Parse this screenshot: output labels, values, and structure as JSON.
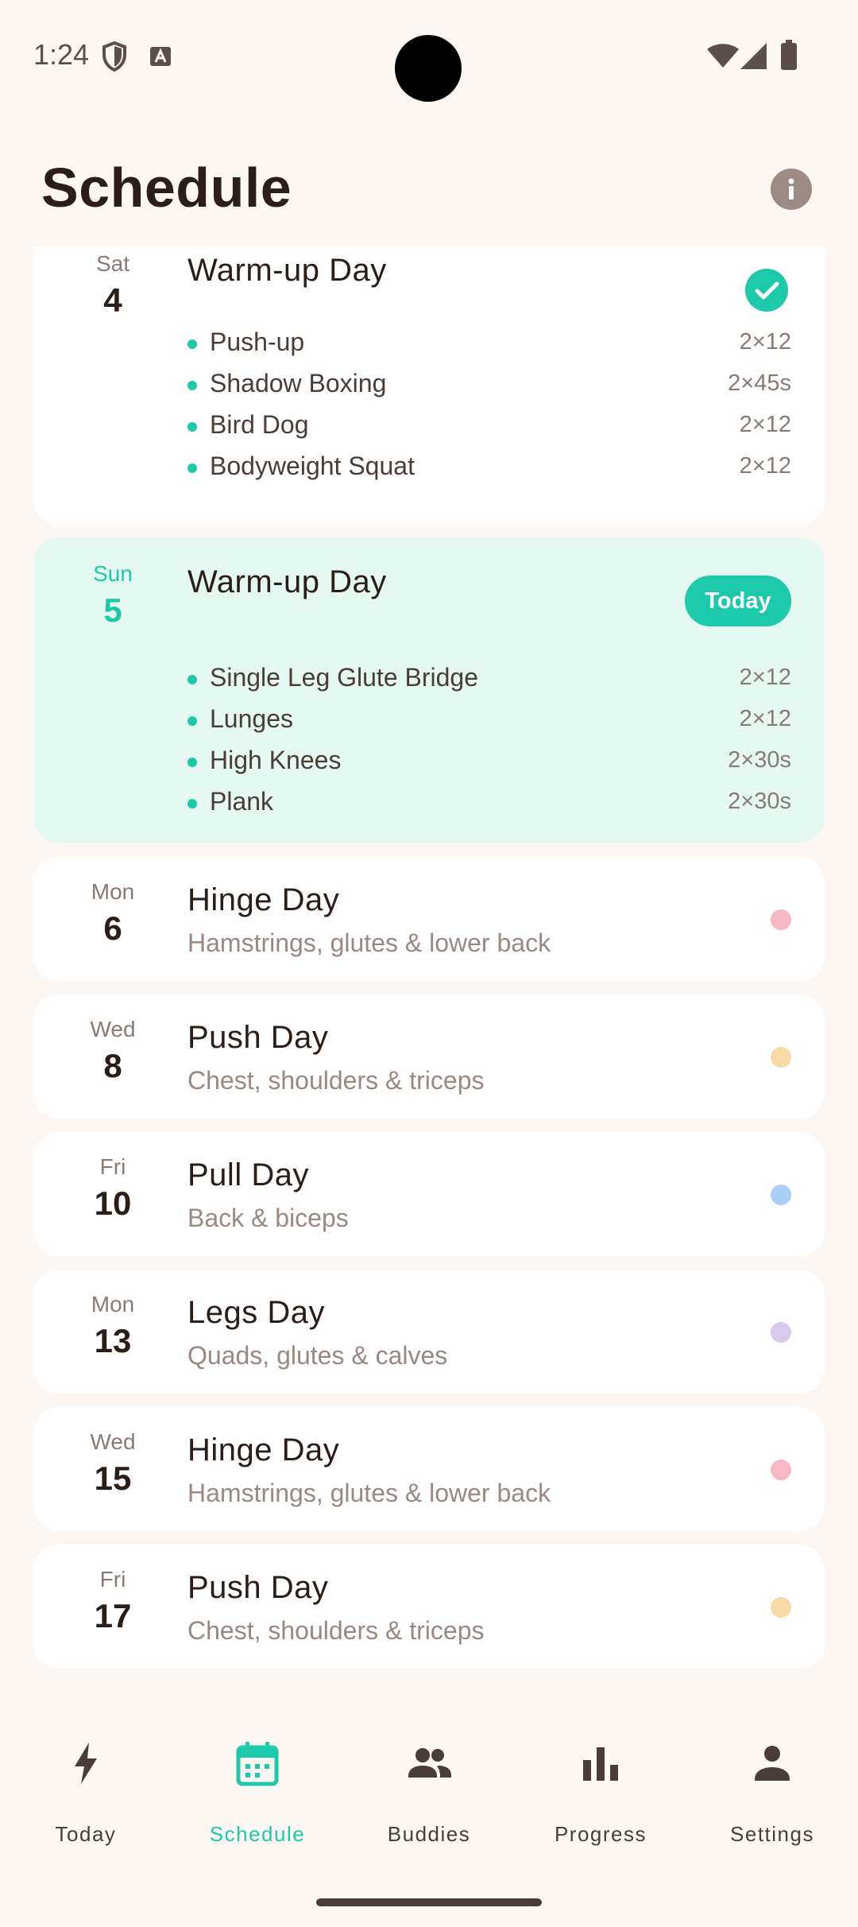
{
  "status_bar": {
    "time": "1:24",
    "icons": [
      "shield-icon",
      "keyboard-icon",
      "wifi-icon",
      "cellular-icon",
      "battery-icon"
    ]
  },
  "header": {
    "title": "Schedule",
    "info_icon": "info-icon"
  },
  "colors": {
    "accent": "#1CC9A8",
    "background": "#FDF7F3",
    "today_card": "#E5F8F2",
    "hinge": "#F8B7C4",
    "push": "#F9D9A6",
    "pull": "#A9CFF7",
    "legs": "#D9C9EE"
  },
  "schedule": [
    {
      "weekday": "Sat",
      "day": "4",
      "title": "Warm-up Day",
      "status": "completed",
      "exercises": [
        {
          "name": "Push-up",
          "sets": "2×12"
        },
        {
          "name": "Shadow Boxing",
          "sets": "2×45s"
        },
        {
          "name": "Bird Dog",
          "sets": "2×12"
        },
        {
          "name": "Bodyweight Squat",
          "sets": "2×12"
        }
      ]
    },
    {
      "weekday": "Sun",
      "day": "5",
      "title": "Warm-up Day",
      "badge": "Today",
      "exercises": [
        {
          "name": "Single Leg Glute Bridge",
          "sets": "2×12"
        },
        {
          "name": "Lunges",
          "sets": "2×12"
        },
        {
          "name": "High Knees",
          "sets": "2×30s"
        },
        {
          "name": "Plank",
          "sets": "2×30s"
        }
      ]
    },
    {
      "weekday": "Mon",
      "day": "6",
      "title": "Hinge Day",
      "subtitle": "Hamstrings, glutes & lower back"
    },
    {
      "weekday": "Wed",
      "day": "8",
      "title": "Push Day",
      "subtitle": "Chest, shoulders & triceps"
    },
    {
      "weekday": "Fri",
      "day": "10",
      "title": "Pull Day",
      "subtitle": "Back & biceps"
    },
    {
      "weekday": "Mon",
      "day": "13",
      "title": "Legs Day",
      "subtitle": "Quads, glutes & calves"
    },
    {
      "weekday": "Wed",
      "day": "15",
      "title": "Hinge Day",
      "subtitle": "Hamstrings, glutes & lower back"
    },
    {
      "weekday": "Fri",
      "day": "17",
      "title": "Push Day",
      "subtitle": "Chest, shoulders & triceps"
    }
  ],
  "nav": {
    "items": [
      {
        "label": "Today",
        "icon": "bolt-icon"
      },
      {
        "label": "Schedule",
        "icon": "calendar-icon",
        "active": true
      },
      {
        "label": "Buddies",
        "icon": "people-icon"
      },
      {
        "label": "Progress",
        "icon": "bar-chart-icon"
      },
      {
        "label": "Settings",
        "icon": "person-icon"
      }
    ]
  }
}
